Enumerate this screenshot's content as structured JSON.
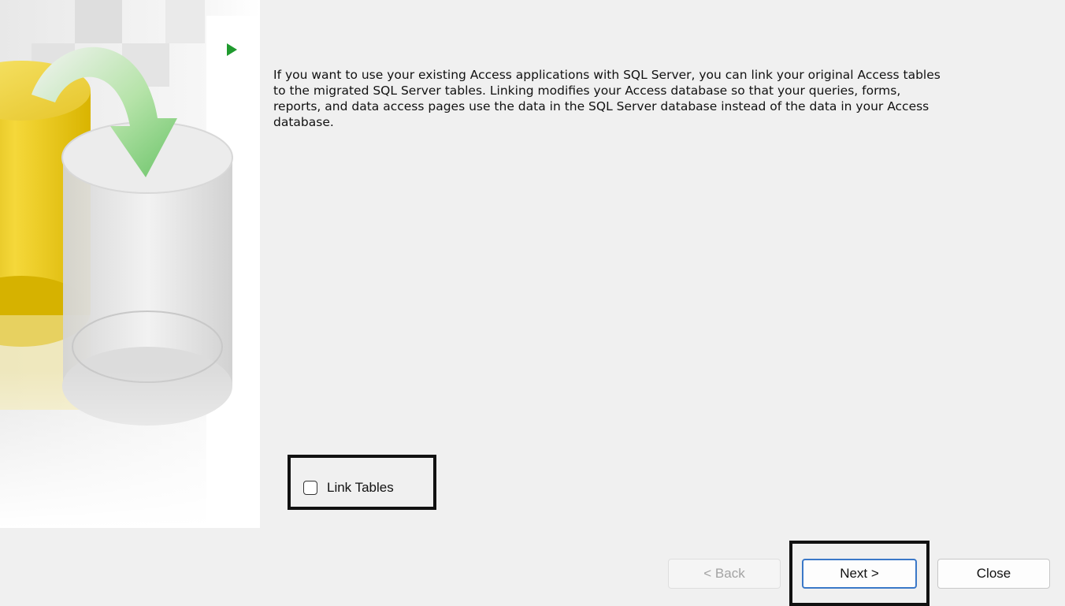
{
  "wizard": {
    "description": "If you want to use your existing Access applications with SQL Server, you can link your original Access tables to the migrated SQL Server tables. Linking modifies your Access database so that your queries, forms, reports, and data access pages use the data in the SQL Server database instead of the data in your Access database.",
    "link_tables": {
      "label": "Link Tables",
      "checked": false
    }
  },
  "buttons": {
    "back_label": "< Back",
    "next_label": "Next >",
    "close_label": "Close"
  },
  "colors": {
    "step_arrow": "#1f9a2e",
    "next_border": "#3a78c8",
    "highlight": "#111111"
  },
  "icons": {
    "banner": "database-migration-illustration",
    "step": "green-triangle-arrow-icon"
  }
}
